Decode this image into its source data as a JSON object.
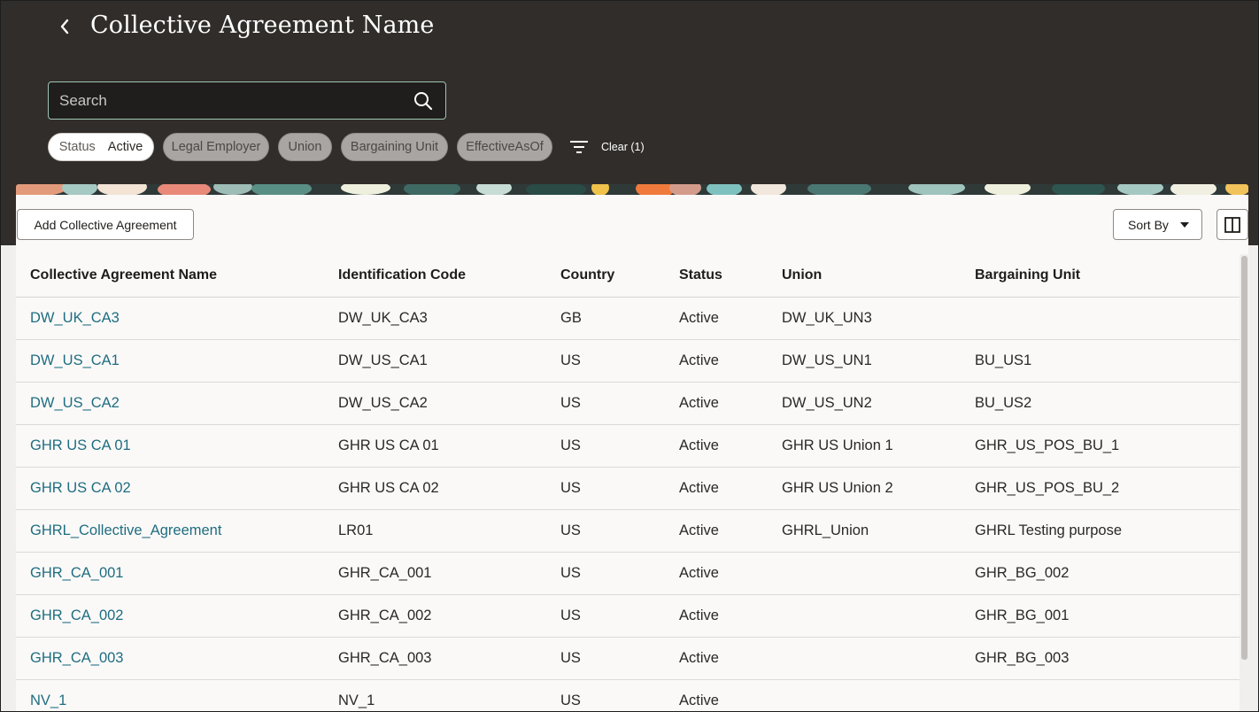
{
  "header": {
    "title": "Collective Agreement Name",
    "back_icon": "chevron-left-icon"
  },
  "search": {
    "placeholder": "Search",
    "value": ""
  },
  "filters": {
    "status": {
      "label": "Status",
      "value": "Active"
    },
    "chips": [
      "Legal Employer",
      "Union",
      "Bargaining Unit",
      "EffectiveAsOf"
    ],
    "clear_label": "Clear (1)"
  },
  "toolbar": {
    "add_label": "Add Collective Agreement",
    "sort_label": "Sort By"
  },
  "table": {
    "columns": [
      "Collective Agreement Name",
      "Identification Code",
      "Country",
      "Status",
      "Union",
      "Bargaining Unit"
    ],
    "rows": [
      [
        "DW_UK_CA3",
        "DW_UK_CA3",
        "GB",
        "Active",
        "DW_UK_UN3",
        ""
      ],
      [
        "DW_US_CA1",
        "DW_US_CA1",
        "US",
        "Active",
        "DW_US_UN1",
        "BU_US1"
      ],
      [
        "DW_US_CA2",
        "DW_US_CA2",
        "US",
        "Active",
        "DW_US_UN2",
        "BU_US2"
      ],
      [
        "GHR US CA 01",
        "GHR US CA 01",
        "US",
        "Active",
        "GHR US Union 1",
        "GHR_US_POS_BU_1"
      ],
      [
        "GHR US CA 02",
        "GHR US CA 02",
        "US",
        "Active",
        "GHR US Union 2",
        "GHR_US_POS_BU_2"
      ],
      [
        "GHRL_Collective_Agreement",
        "LR01",
        "US",
        "Active",
        "GHRL_Union",
        "GHRL Testing purpose"
      ],
      [
        "GHR_CA_001",
        "GHR_CA_001",
        "US",
        "Active",
        "",
        "GHR_BG_002"
      ],
      [
        "GHR_CA_002",
        "GHR_CA_002",
        "US",
        "Active",
        "",
        "GHR_BG_001"
      ],
      [
        "GHR_CA_003",
        "GHR_CA_003",
        "US",
        "Active",
        "",
        "GHR_BG_003"
      ],
      [
        "NV_1",
        "NV_1",
        "US",
        "Active",
        "",
        ""
      ]
    ]
  },
  "colors": {
    "header_bg": "#312d2a",
    "link": "#1f6d80",
    "panel_bg": "#faf9f8"
  }
}
